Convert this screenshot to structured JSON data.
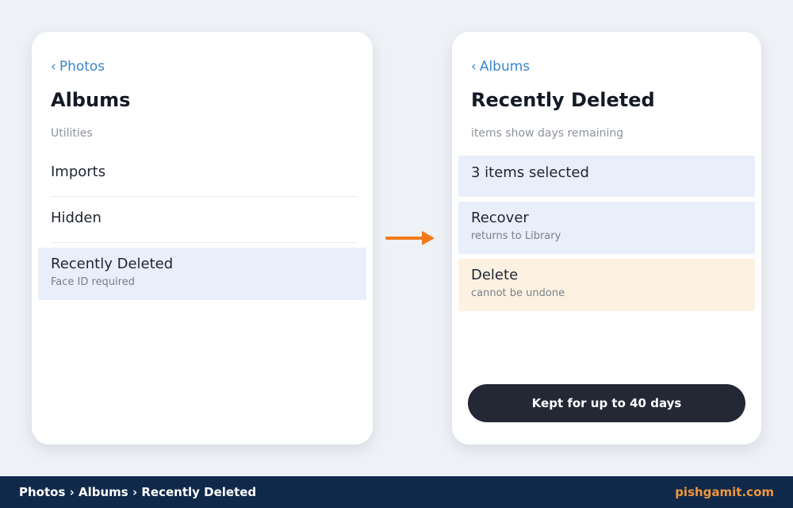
{
  "left_screen": {
    "back_label": "Photos",
    "title": "Albums",
    "section_label": "Utilities",
    "items": [
      {
        "label": "Imports"
      },
      {
        "label": "Hidden"
      },
      {
        "label": "Recently Deleted",
        "sublabel": "Face ID required"
      }
    ]
  },
  "right_screen": {
    "back_label": "Albums",
    "title": "Recently Deleted",
    "hint": "items show days remaining",
    "selection": "3 items selected",
    "recover": {
      "label": "Recover",
      "sublabel": "returns to Library"
    },
    "delete": {
      "label": "Delete",
      "sublabel": "cannot be undone"
    },
    "kept_button": "Kept for up to 40 days"
  },
  "footer": {
    "breadcrumb": "Photos › Albums › Recently Deleted",
    "brand": "pishgamit.com"
  },
  "icons": {
    "back": "chevron-left-icon",
    "flow": "arrow-right-icon"
  },
  "colors": {
    "link": "#3a86c8",
    "highlight": "#e8eefa",
    "warning": "#fdf2e2",
    "arrow": "#f27a1a",
    "footer": "#10294a",
    "brand": "#f0973a",
    "button": "#232834"
  }
}
